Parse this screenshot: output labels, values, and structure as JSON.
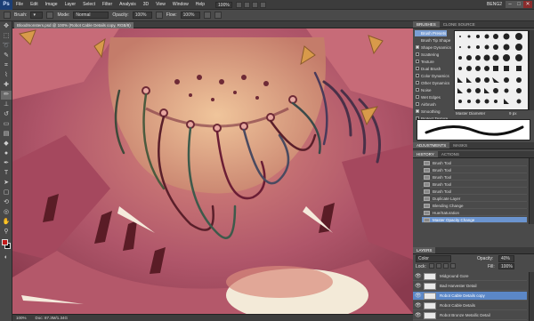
{
  "menubar": {
    "logo": "Ps",
    "items": [
      "File",
      "Edit",
      "Image",
      "Layer",
      "Select",
      "Filter",
      "Analysis",
      "3D",
      "View",
      "Window",
      "Help"
    ],
    "zoom": "100%",
    "workspace": "BENG2",
    "win_buttons": [
      "–",
      "□",
      "✕"
    ]
  },
  "options": {
    "brush_label": "Brush:",
    "mode_label": "Mode:",
    "mode_value": "Normal",
    "opacity_label": "Opacity:",
    "opacity_value": "100%",
    "flow_label": "Flow:",
    "flow_value": "100%"
  },
  "document": {
    "tab_label": "Bloodmonsters.psd @ 100% (Robot Cable Details copy, RGB/8)",
    "status_zoom": "100%",
    "status_doc": "Doc: 87.3M/1.34G"
  },
  "brushes_panel": {
    "tabs": [
      "BRUSHES",
      "CLONE SOURCE"
    ],
    "options": [
      "Brush Presets",
      "Brush Tip Shape",
      "Shape Dynamics",
      "Scattering",
      "Texture",
      "Dual Brush",
      "Color Dynamics",
      "Other Dynamics",
      "Noise",
      "Wet Edges",
      "Airbrush",
      "Smoothing",
      "Protect Texture"
    ],
    "master_diameter_label": "Master Diameter",
    "master_diameter_value": "9 px"
  },
  "adjust_tabs": [
    "ADJUSTMENTS",
    "MASKS"
  ],
  "history_panel": {
    "tabs": [
      "HISTORY",
      "ACTIONS"
    ],
    "rows": [
      "Brush Tool",
      "Brush Tool",
      "Brush Tool",
      "Brush Tool",
      "Brush Tool",
      "Duplicate Layer",
      "Blending Change",
      "Hue/Saturation",
      "Master Opacity Change"
    ]
  },
  "layers_panel": {
    "tabs": [
      "LAYERS"
    ],
    "blend_mode": "Color",
    "opacity_label": "Opacity:",
    "opacity_value": "40%",
    "lock_label": "Lock:",
    "fill_label": "Fill:",
    "fill_value": "100%",
    "rows": [
      "Midground Gore",
      "Bad Harvester Detail",
      "Robot Cable Details copy",
      "Robot Cable Details",
      "Robot Bronze Metallic Detail"
    ]
  },
  "colors": {
    "accent": "#6b94cf",
    "foreground": "#c21a1a",
    "background": "#1a1a1a"
  }
}
